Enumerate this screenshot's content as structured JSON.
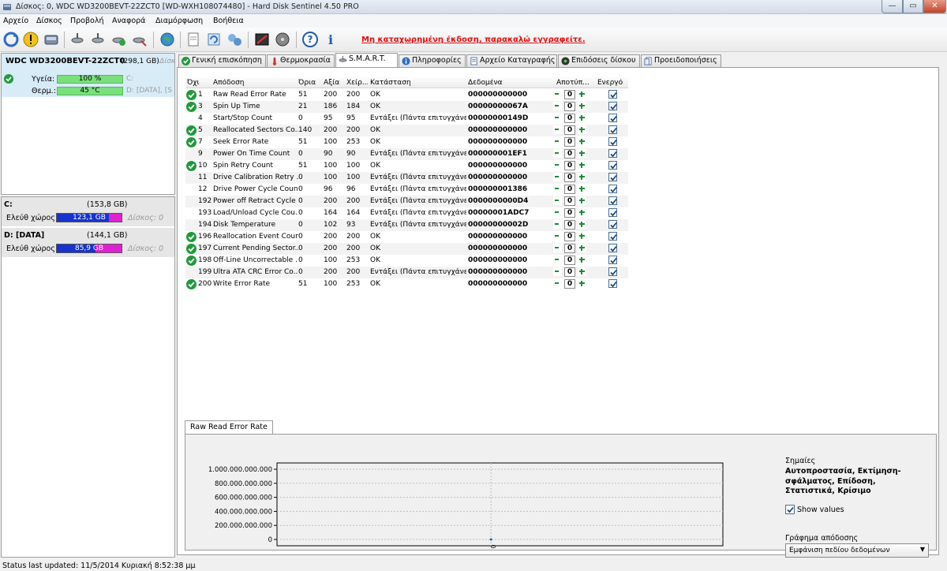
{
  "window": {
    "title": "Δίσκος: 0, WDC WD3200BEVT-22ZCT0 [WD-WXH108074480]  -  Hard Disk Sentinel 4.50 PRO",
    "min_label": "—",
    "max_label": "▭",
    "close_label": "✕"
  },
  "menu": [
    "Αρχείο",
    "Δίσκος",
    "Προβολή",
    "Αναφορά",
    "Διαμόρφωση",
    "Βοήθεια"
  ],
  "toolbar": {
    "registration_notice": "Μη καταχωρημένη έκδοση, παρακαλώ εγγραφείτε."
  },
  "disk": {
    "name": "WDC WD3200BEVT-22ZCT0",
    "size": "(298,1 GB)",
    "slot": "Δίσκος",
    "health_label": "Υγεία:",
    "health_value": "100 %",
    "health_pct": 100,
    "temp_label": "Θερμ.:",
    "temp_value": "45 °C",
    "health_parts": "C:",
    "temp_parts": "D: [DATA],  [S"
  },
  "partitions": [
    {
      "name": "C:",
      "size": "(153,8 GB)",
      "free_label": "Ελεύθ χώρος",
      "free_value": "123,1 GB",
      "free_pct": 80,
      "disk": "Δίσκος: 0"
    },
    {
      "name": "D: [DATA]",
      "size": "(144,1 GB)",
      "free_label": "Ελεύθ χώρος",
      "free_value": "85,9 GB",
      "free_pct": 60,
      "disk": "Δίσκος: 0"
    }
  ],
  "tabs": [
    "Γενική επισκόπηση",
    "Θερμοκρασία",
    "S.M.A.R.T.",
    "Πληροφορίες",
    "Αρχείο Καταγραφής",
    "Επιδόσεις δίσκου",
    "Προειδοποιήσεις"
  ],
  "smart": {
    "columns": [
      "Όχι.",
      "Απόδοση",
      "Όρια",
      "Αξία",
      "Χείρ...",
      "Κατάσταση",
      "Δεδομένα",
      "Αποτύπ...",
      "Ενεργό"
    ],
    "rows": [
      {
        "ok": true,
        "id": "1",
        "name": "Raw Read Error Rate",
        "thr": "51",
        "val": "200",
        "worst": "200",
        "status": "OK",
        "data": "000000000000",
        "adj": "0"
      },
      {
        "ok": true,
        "id": "3",
        "name": "Spin Up Time",
        "thr": "21",
        "val": "186",
        "worst": "184",
        "status": "OK",
        "data": "00000000067A",
        "adj": "0"
      },
      {
        "ok": false,
        "id": "4",
        "name": "Start/Stop Count",
        "thr": "0",
        "val": "95",
        "worst": "95",
        "status": "Εντάξει (Πάντα επιτυγχάνει)",
        "data": "00000000149D",
        "adj": "0"
      },
      {
        "ok": true,
        "id": "5",
        "name": "Reallocated Sectors Co...",
        "thr": "140",
        "val": "200",
        "worst": "200",
        "status": "OK",
        "data": "000000000000",
        "adj": "0"
      },
      {
        "ok": true,
        "id": "7",
        "name": "Seek Error Rate",
        "thr": "51",
        "val": "100",
        "worst": "253",
        "status": "OK",
        "data": "000000000000",
        "adj": "0"
      },
      {
        "ok": false,
        "id": "9",
        "name": "Power On Time Count",
        "thr": "0",
        "val": "90",
        "worst": "90",
        "status": "Εντάξει (Πάντα επιτυγχάνει)",
        "data": "000000001EF1",
        "adj": "0"
      },
      {
        "ok": true,
        "id": "10",
        "name": "Spin Retry Count",
        "thr": "51",
        "val": "100",
        "worst": "100",
        "status": "OK",
        "data": "000000000000",
        "adj": "0"
      },
      {
        "ok": false,
        "id": "11",
        "name": "Drive Calibration Retry ...",
        "thr": "0",
        "val": "100",
        "worst": "100",
        "status": "Εντάξει (Πάντα επιτυγχάνει)",
        "data": "000000000000",
        "adj": "0"
      },
      {
        "ok": false,
        "id": "12",
        "name": "Drive Power Cycle Count",
        "thr": "0",
        "val": "96",
        "worst": "96",
        "status": "Εντάξει (Πάντα επιτυγχάνει)",
        "data": "000000001386",
        "adj": "0"
      },
      {
        "ok": false,
        "id": "192",
        "name": "Power off Retract Cycle ...",
        "thr": "0",
        "val": "200",
        "worst": "200",
        "status": "Εντάξει (Πάντα επιτυγχάνει)",
        "data": "0000000000D4",
        "adj": "0"
      },
      {
        "ok": false,
        "id": "193",
        "name": "Load/Unload Cycle Cou...",
        "thr": "0",
        "val": "164",
        "worst": "164",
        "status": "Εντάξει (Πάντα επιτυγχάνει)",
        "data": "00000001ADC7",
        "adj": "0"
      },
      {
        "ok": false,
        "id": "194",
        "name": "Disk Temperature",
        "thr": "0",
        "val": "102",
        "worst": "93",
        "status": "Εντάξει (Πάντα επιτυγχάνει)",
        "data": "00000000002D",
        "adj": "0"
      },
      {
        "ok": true,
        "id": "196",
        "name": "Reallocation Event Count",
        "thr": "0",
        "val": "200",
        "worst": "200",
        "status": "OK",
        "data": "000000000000",
        "adj": "0"
      },
      {
        "ok": true,
        "id": "197",
        "name": "Current Pending Sector...",
        "thr": "0",
        "val": "200",
        "worst": "200",
        "status": "OK",
        "data": "000000000000",
        "adj": "0"
      },
      {
        "ok": true,
        "id": "198",
        "name": "Off-Line Uncorrectable ...",
        "thr": "0",
        "val": "100",
        "worst": "253",
        "status": "OK",
        "data": "000000000000",
        "adj": "0"
      },
      {
        "ok": false,
        "id": "199",
        "name": "Ultra ATA CRC Error Co...",
        "thr": "0",
        "val": "200",
        "worst": "200",
        "status": "Εντάξει (Πάντα επιτυγχάνει)",
        "data": "000000000000",
        "adj": "0"
      },
      {
        "ok": true,
        "id": "200",
        "name": "Write Error Rate",
        "thr": "51",
        "val": "100",
        "worst": "253",
        "status": "OK",
        "data": "000000000000",
        "adj": "0"
      }
    ]
  },
  "chart_panel": {
    "tab": "Raw Read Error Rate",
    "flags_title": "Σημαίες",
    "flags_text": "Αυτοπροστασία, Εκτίμηση-σφάλματος, Επίδοση, Στατιστικά, Κρίσιμο",
    "show_values": "Show values",
    "perf_title": "Γράφημα απόδοσης",
    "perf_select": "Εμφάνιση πεδίου δεδομένων"
  },
  "chart_data": {
    "type": "line",
    "y_ticks": [
      "1.000.000.000.000",
      "800.000.000.000",
      "600.000.000.000",
      "400.000.000.000",
      "200.000.000.000",
      "0"
    ],
    "ylim": [
      0,
      1000000000000
    ],
    "x_ticks": [
      "0"
    ],
    "series": [
      {
        "values": [
          0
        ]
      }
    ],
    "grid": true
  },
  "status": {
    "text": "Status last updated: 11/5/2014 Κυριακή 8:52:38 μμ"
  },
  "colors": {
    "ok_green": "#1f9a3a",
    "health_bar": "#79e07c",
    "free_bar": "#1733cc",
    "used_bar": "#e020d0",
    "notice_red": "#e01010"
  }
}
